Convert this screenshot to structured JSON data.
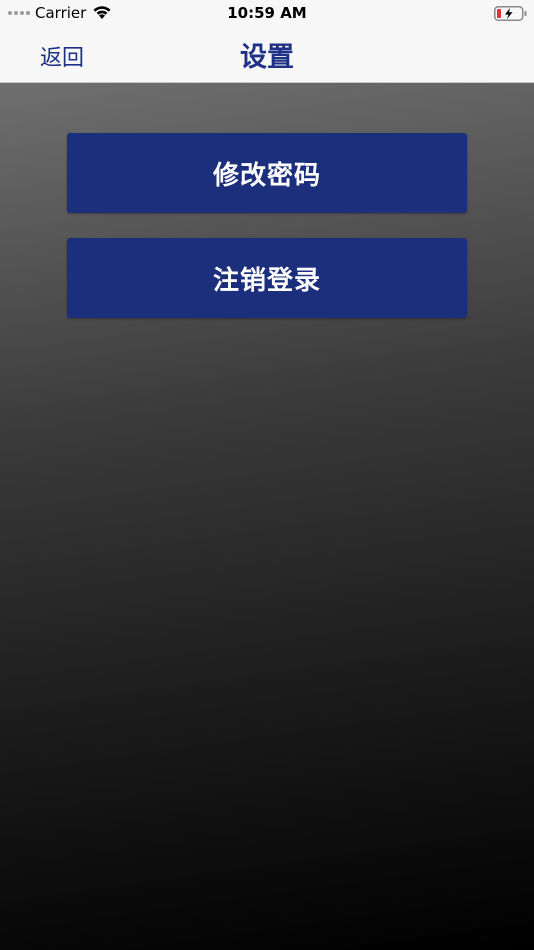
{
  "status_bar": {
    "carrier": "Carrier",
    "time": "10:59 AM",
    "wifi_icon": "wifi-icon",
    "battery_icon": "battery-charging-icon"
  },
  "nav": {
    "back_label": "返回",
    "title": "设置"
  },
  "buttons": {
    "change_password": "修改密码",
    "logout": "注销登录"
  },
  "colors": {
    "accent": "#1f3186",
    "button_bg": "#1c2f7d",
    "nav_bg": "#f7f7f7",
    "battery_low": "#e0342c"
  }
}
